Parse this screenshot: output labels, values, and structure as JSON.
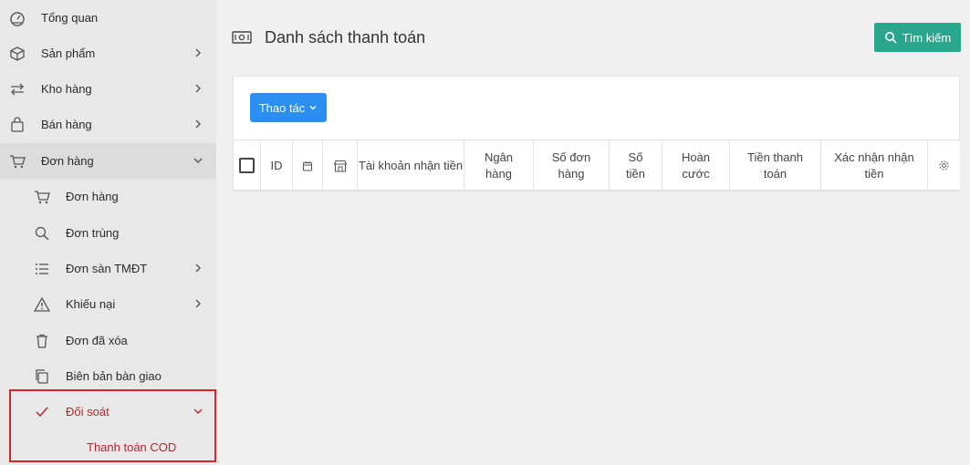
{
  "sidebar": {
    "items": [
      {
        "label": "Tổng quan"
      },
      {
        "label": "Sản phẩm"
      },
      {
        "label": "Kho hàng"
      },
      {
        "label": "Bán hàng"
      },
      {
        "label": "Đơn hàng"
      }
    ],
    "subitems": [
      {
        "label": "Đơn hàng"
      },
      {
        "label": "Đơn trùng"
      },
      {
        "label": "Đơn sàn TMĐT"
      },
      {
        "label": "Khiếu nại"
      },
      {
        "label": "Đơn đã xóa"
      },
      {
        "label": "Biên bản bàn giao"
      },
      {
        "label": "Đối soát"
      },
      {
        "label": "Thanh toán COD"
      }
    ]
  },
  "header": {
    "title": "Danh sách thanh toán",
    "search_label": "Tìm kiếm"
  },
  "toolbar": {
    "action_label": "Thao tác"
  },
  "table": {
    "columns": [
      "ID",
      "Tài khoản nhận tiền",
      "Ngân hàng",
      "Số đơn hàng",
      "Số tiền",
      "Hoàn cước",
      "Tiền thanh toán",
      "Xác nhận nhận tiền"
    ]
  },
  "colors": {
    "primary": "#2a8ff0",
    "search": "#2aa68c",
    "highlight": "#d9262b"
  }
}
